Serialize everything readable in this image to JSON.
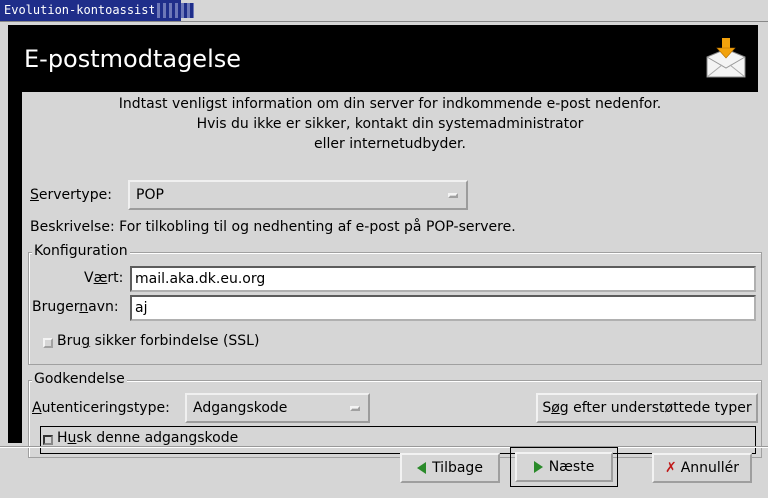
{
  "window": {
    "title": "Evolution-kontoassistent"
  },
  "header": {
    "title": "E-postmodtagelse",
    "icon": "mail-download-icon"
  },
  "intro": {
    "line1": "Indtast venligst information om din server for indkommende e-post nedenfor.",
    "line2": "Hvis du ikke er sikker, kontakt din systemadministrator",
    "line3": "eller internetudbyder."
  },
  "servertype": {
    "label_u": "S",
    "label_rest": "ervertype:",
    "value": "POP"
  },
  "description": {
    "label": "Beskrivelse:",
    "text": "For tilkobling til og nedhenting af e-post på POP-servere."
  },
  "config": {
    "title": "Konfiguration",
    "host_label_pre": "V",
    "host_label_u": "æ",
    "host_label_post": "rt:",
    "host_value": "mail.aka.dk.eu.org",
    "user_label_pre": "Bruger",
    "user_label_u": "n",
    "user_label_post": "avn:",
    "user_value": "aj",
    "ssl_pre": "Bru",
    "ssl_u": "g",
    "ssl_post": " sikker forbindelse (SSL)"
  },
  "auth": {
    "title": "Godkendelse",
    "type_label_u": "A",
    "type_label_rest": "utenticeringstype:",
    "type_value": "Adgangskode",
    "search_pre": "S",
    "search_u": "ø",
    "search_post": "g efter understøttede typer",
    "remember_pre": "H",
    "remember_u": "u",
    "remember_post": "sk denne adgangskode"
  },
  "buttons": {
    "back": "Tilbage",
    "next": "Næste",
    "cancel": "Annullér"
  }
}
